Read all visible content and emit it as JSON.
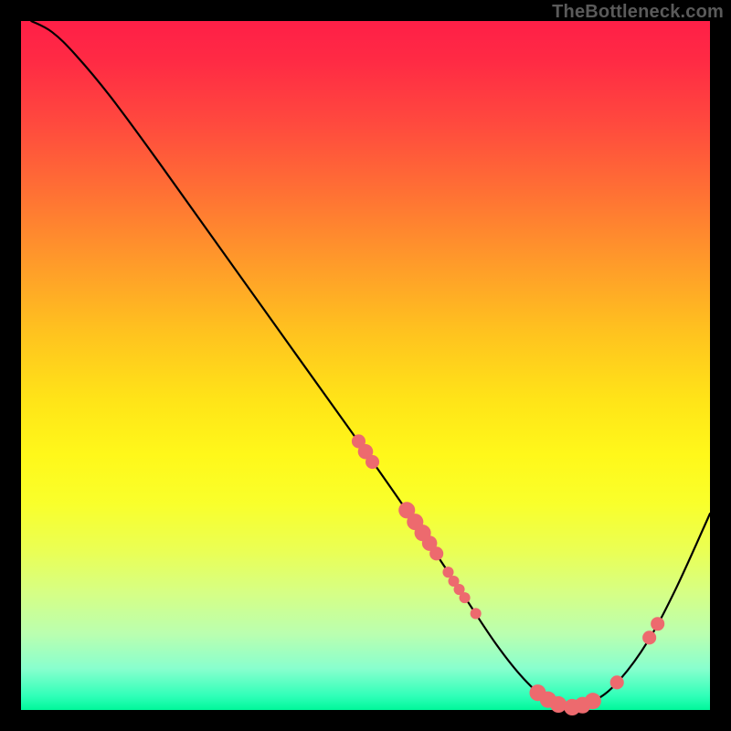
{
  "attribution": "TheBottleneck.com",
  "chart_data": {
    "type": "line",
    "title": "",
    "xlabel": "",
    "ylabel": "",
    "xlim": [
      0,
      100
    ],
    "ylim": [
      0,
      100
    ],
    "curve": [
      {
        "x": 1.5,
        "y": 100
      },
      {
        "x": 4.5,
        "y": 98.4
      },
      {
        "x": 8,
        "y": 95
      },
      {
        "x": 13,
        "y": 89
      },
      {
        "x": 20,
        "y": 79.5
      },
      {
        "x": 30,
        "y": 65.5
      },
      {
        "x": 40,
        "y": 51.5
      },
      {
        "x": 50,
        "y": 37.5
      },
      {
        "x": 58,
        "y": 26
      },
      {
        "x": 64,
        "y": 17
      },
      {
        "x": 69,
        "y": 9.5
      },
      {
        "x": 73,
        "y": 4.5
      },
      {
        "x": 76.5,
        "y": 1.5
      },
      {
        "x": 80,
        "y": 0.5
      },
      {
        "x": 83.5,
        "y": 1.5
      },
      {
        "x": 87,
        "y": 4.5
      },
      {
        "x": 91,
        "y": 10
      },
      {
        "x": 95,
        "y": 17.5
      },
      {
        "x": 100,
        "y": 28.5
      }
    ],
    "dots": [
      {
        "x": 49.0,
        "y": 39.0,
        "r": 1.0
      },
      {
        "x": 50.0,
        "y": 37.5,
        "r": 1.1
      },
      {
        "x": 51.0,
        "y": 36.0,
        "r": 1.0
      },
      {
        "x": 56.0,
        "y": 29.0,
        "r": 1.2
      },
      {
        "x": 57.2,
        "y": 27.3,
        "r": 1.2
      },
      {
        "x": 58.3,
        "y": 25.7,
        "r": 1.2
      },
      {
        "x": 59.3,
        "y": 24.2,
        "r": 1.1
      },
      {
        "x": 60.3,
        "y": 22.7,
        "r": 1.0
      },
      {
        "x": 62.0,
        "y": 20.0,
        "r": 0.8
      },
      {
        "x": 62.8,
        "y": 18.7,
        "r": 0.8
      },
      {
        "x": 63.6,
        "y": 17.5,
        "r": 0.8
      },
      {
        "x": 64.4,
        "y": 16.3,
        "r": 0.8
      },
      {
        "x": 66.0,
        "y": 14.0,
        "r": 0.8
      },
      {
        "x": 75.0,
        "y": 2.5,
        "r": 1.2
      },
      {
        "x": 76.5,
        "y": 1.5,
        "r": 1.2
      },
      {
        "x": 78.0,
        "y": 0.8,
        "r": 1.2
      },
      {
        "x": 80.0,
        "y": 0.4,
        "r": 1.2
      },
      {
        "x": 81.5,
        "y": 0.7,
        "r": 1.2
      },
      {
        "x": 83.0,
        "y": 1.3,
        "r": 1.2
      },
      {
        "x": 86.5,
        "y": 4.0,
        "r": 1.0
      },
      {
        "x": 91.2,
        "y": 10.5,
        "r": 1.0
      },
      {
        "x": 92.4,
        "y": 12.5,
        "r": 1.0
      }
    ],
    "dot_color": "#ed6a6e",
    "curve_color": "#000000"
  }
}
